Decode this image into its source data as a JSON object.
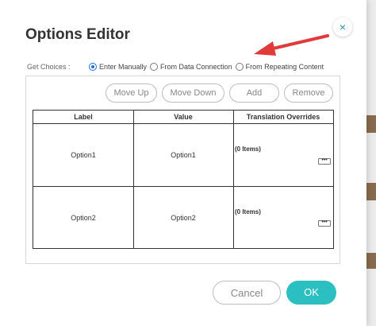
{
  "dialog": {
    "title": "Options Editor",
    "close_glyph": "×"
  },
  "choices": {
    "label": "Get Choices :",
    "options": [
      {
        "label": "Enter Manually",
        "selected": true
      },
      {
        "label": "From Data Connection",
        "selected": false
      },
      {
        "label": "From Repeating Content",
        "selected": false
      }
    ]
  },
  "toolbar": {
    "move_up": "Move Up",
    "move_down": "Move Down",
    "add": "Add",
    "remove": "Remove"
  },
  "table": {
    "headers": [
      "Label",
      "Value",
      "Translation Overrides"
    ],
    "rows": [
      {
        "label": "Option1",
        "value": "Option1",
        "overrides": "(0 Items)",
        "more": "•••"
      },
      {
        "label": "Option2",
        "value": "Option2",
        "overrides": "(0 Items)",
        "more": "•••"
      }
    ]
  },
  "footer": {
    "cancel": "Cancel",
    "ok": "OK"
  },
  "colors": {
    "accent": "#2bbfc2",
    "radio_selected": "#1a6fd6",
    "annotation_arrow": "#e03a3a"
  }
}
